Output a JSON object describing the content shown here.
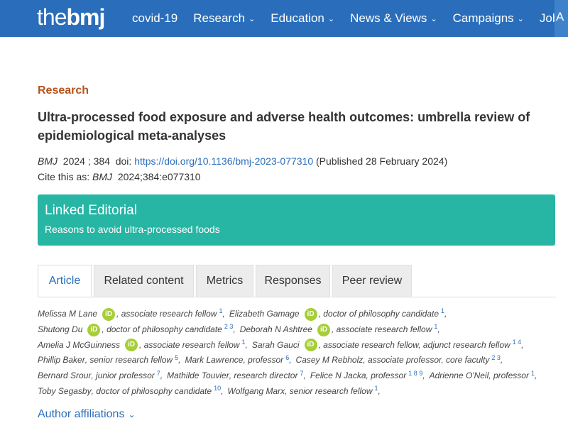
{
  "header": {
    "logo_the": "the",
    "logo_bmj": "bmj",
    "nav": [
      {
        "label": "covid-19",
        "has_menu": false
      },
      {
        "label": "Research",
        "has_menu": true
      },
      {
        "label": "Education",
        "has_menu": true
      },
      {
        "label": "News & Views",
        "has_menu": true
      },
      {
        "label": "Campaigns",
        "has_menu": true
      },
      {
        "label": "Jobs",
        "has_menu": true
      }
    ],
    "nav_edge": "A",
    "chevron": "⌄",
    "bar_color": "#2a6ebb"
  },
  "article": {
    "section": "Research",
    "title": "Ultra-processed food exposure and adverse health outcomes: umbrella review of epidemiological meta-analyses",
    "journal": "BMJ",
    "year_vol": "2024 ; 384",
    "doi_label": "doi:",
    "doi": "https://doi.org/10.1136/bmj-2023-077310",
    "published": "(Published 28 February 2024)",
    "cite_label": "Cite this as:",
    "cite_journal": "BMJ",
    "cite_ref": "2024;384:e077310"
  },
  "editorial": {
    "heading": "Linked Editorial",
    "link": "Reasons to avoid ultra-processed foods",
    "color": "#27b5a4"
  },
  "tabs": [
    {
      "label": "Article",
      "active": true
    },
    {
      "label": "Related content",
      "active": false
    },
    {
      "label": "Metrics",
      "active": false
    },
    {
      "label": "Responses",
      "active": false
    },
    {
      "label": "Peer review",
      "active": false
    }
  ],
  "orcid_label": "iD",
  "author_lines": [
    [
      {
        "name": "Melissa M Lane",
        "orcid": true,
        "role": "associate research fellow",
        "aff": "1"
      },
      {
        "name": "Elizabeth Gamage",
        "orcid": true,
        "role": "doctor of philosophy candidate",
        "aff": "1"
      }
    ],
    [
      {
        "name": "Shutong Du",
        "orcid": true,
        "role": "doctor of philosophy candidate",
        "aff": "2 3"
      },
      {
        "name": "Deborah N Ashtree",
        "orcid": true,
        "role": "associate research fellow",
        "aff": "1"
      }
    ],
    [
      {
        "name": "Amelia J McGuinness",
        "orcid": true,
        "role": "associate research fellow",
        "aff": "1"
      },
      {
        "name": "Sarah Gauci",
        "orcid": true,
        "role": "associate research fellow, adjunct research fellow",
        "aff": "1 4"
      }
    ],
    [
      {
        "name": "Phillip Baker",
        "orcid": false,
        "role": "senior research fellow",
        "aff": "5"
      },
      {
        "name": "Mark Lawrence",
        "orcid": false,
        "role": "professor",
        "aff": "6"
      },
      {
        "name": "Casey M Rebholz",
        "orcid": false,
        "role": "associate professor, core faculty",
        "aff": "2 3"
      }
    ],
    [
      {
        "name": "Bernard Srour",
        "orcid": false,
        "role": "junior professor",
        "aff": "7"
      },
      {
        "name": "Mathilde Touvier",
        "orcid": false,
        "role": "research director",
        "aff": "7"
      },
      {
        "name": "Felice N Jacka",
        "orcid": false,
        "role": "professor",
        "aff": "1 8 9"
      },
      {
        "name": "Adrienne O'Neil",
        "orcid": false,
        "role": "professor",
        "aff": "1"
      }
    ],
    [
      {
        "name": "Toby Segasby",
        "orcid": false,
        "role": "doctor of philosophy candidate",
        "aff": "10"
      },
      {
        "name": "Wolfgang Marx",
        "orcid": false,
        "role": "senior research fellow",
        "aff": "1"
      }
    ]
  ],
  "affiliations_label": "Author affiliations",
  "affiliations_chevron": "⌄"
}
